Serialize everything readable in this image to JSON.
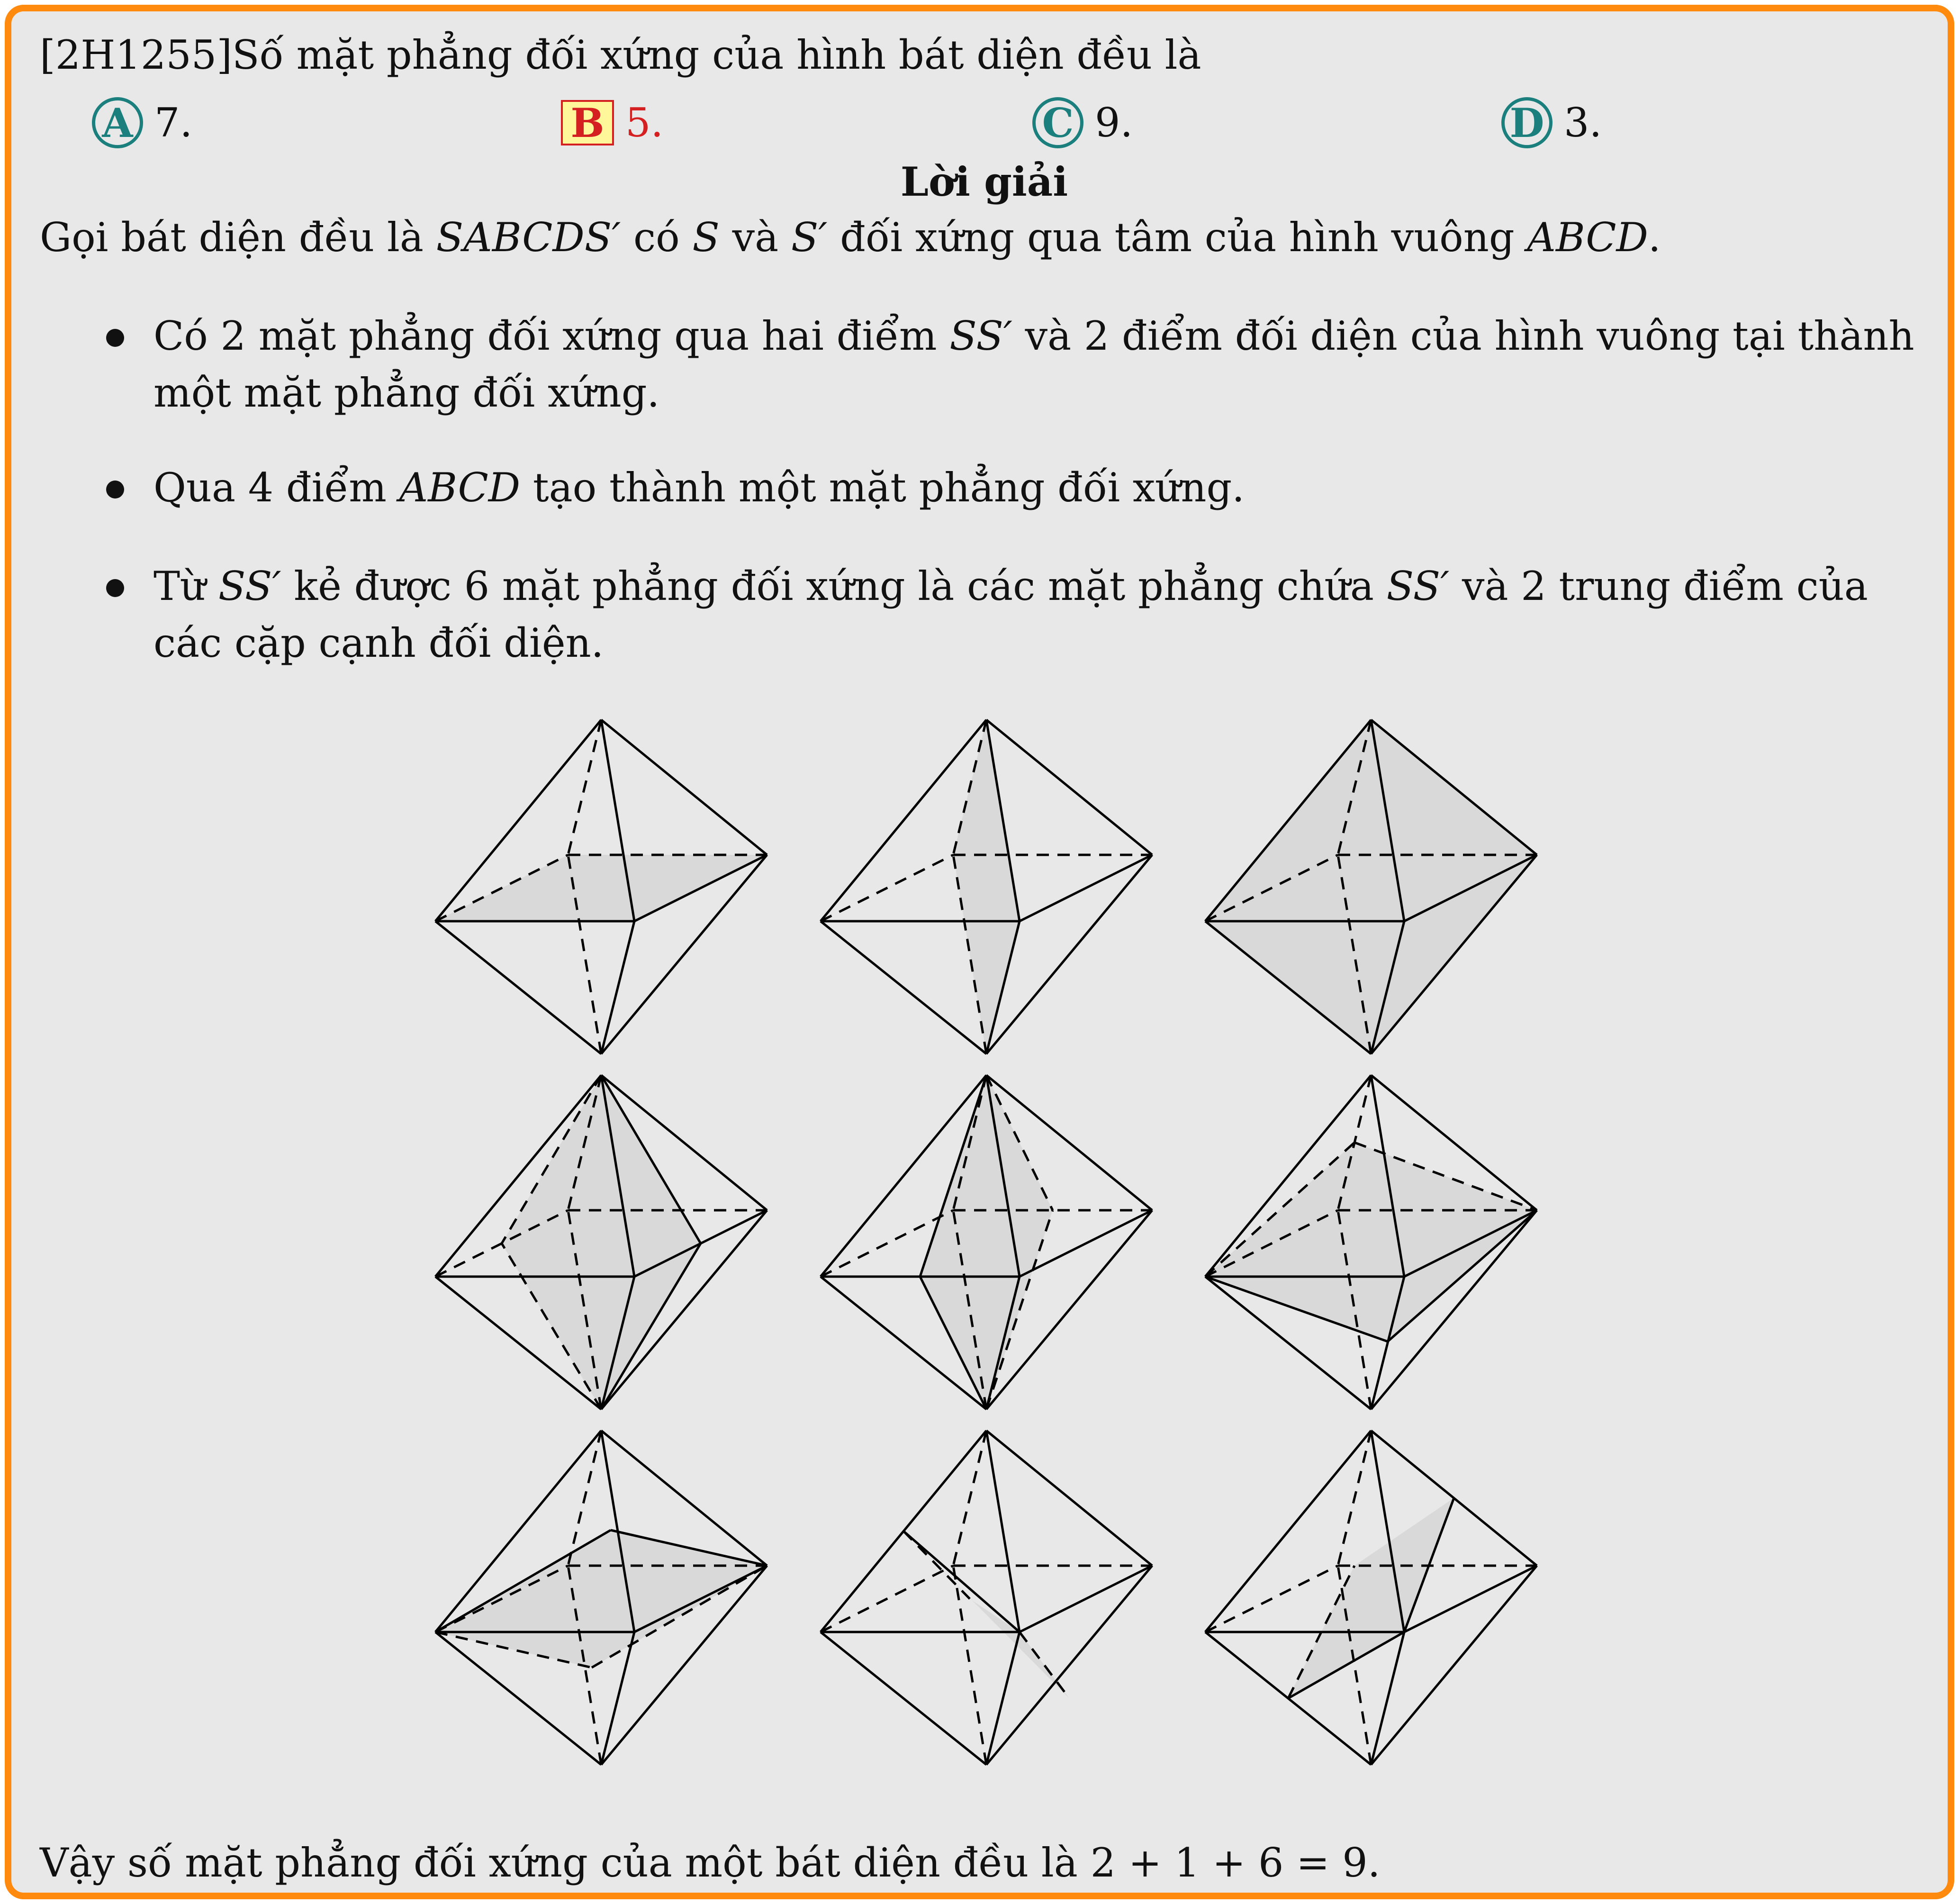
{
  "question": {
    "code": "[2H1255]",
    "text": "Số mặt phẳng đối xứng của hình bát diện đều là"
  },
  "choices": [
    {
      "letter": "A",
      "value": "7.",
      "correct": false
    },
    {
      "letter": "B",
      "value": "5.",
      "correct": true
    },
    {
      "letter": "C",
      "value": "9.",
      "correct": false
    },
    {
      "letter": "D",
      "value": "3.",
      "correct": false
    }
  ],
  "solution": {
    "heading": "Lời giải",
    "intro": {
      "p1": "Gọi bát diện đều là ",
      "m1": "SABCDS′",
      "p2": " có ",
      "m2": "S",
      "p3": " và ",
      "m3": "S′",
      "p4": " đối xứng qua tâm của hình vuông ",
      "m4": "ABCD",
      "p5": "."
    },
    "bullets": [
      {
        "p1": "Có 2 mặt phẳng đối xứng qua hai điểm ",
        "m1": "SS′",
        "p2": " và 2 điểm đối diện của hình vuông tại thành",
        "line2": "một mặt phẳng đối xứng."
      },
      {
        "p1": "Qua 4 điểm ",
        "m1": "ABCD",
        "p2": " tạo thành một mặt phẳng đối xứng."
      },
      {
        "p1": "Từ ",
        "m1": "SS′",
        "p2": " kẻ được 6 mặt phẳng đối xứng là các mặt phẳng chứa ",
        "m2": "SS′",
        "p3": " và 2 trung điểm của",
        "line2": "các cặp cạnh đối diện."
      }
    ],
    "conclusion": {
      "text": "Vậy số mặt phẳng đối xứng của một bát diện đều là ",
      "equation": "2 + 1 + 6 = 9",
      "end": "."
    }
  },
  "figure": {
    "grid_rows": 3,
    "grid_cols": 3,
    "plane_fill": "#d9d9d9"
  }
}
